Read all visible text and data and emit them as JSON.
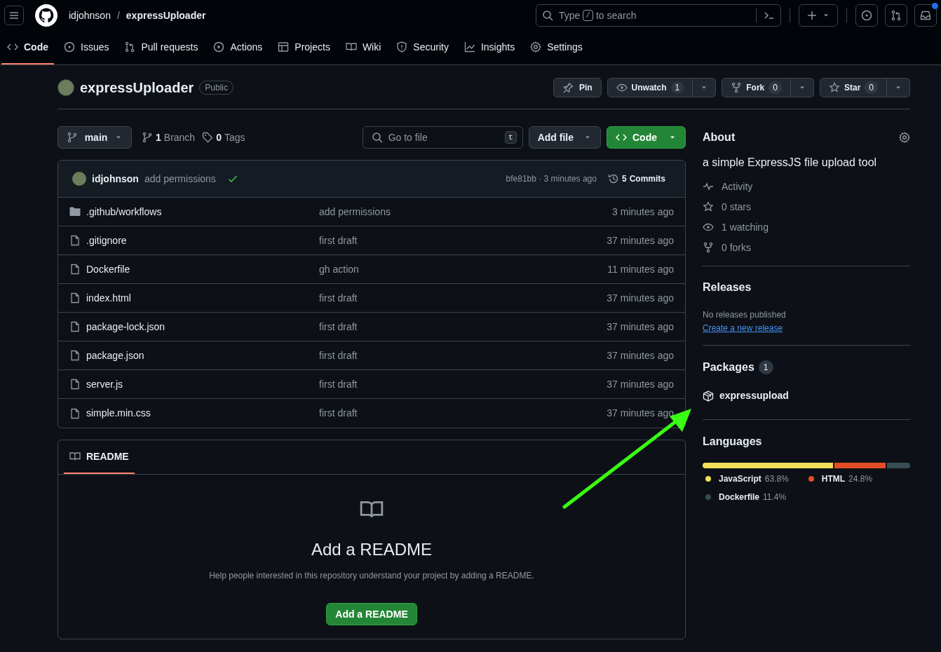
{
  "header": {
    "owner": "idjohnson",
    "separator": "/",
    "repo": "expressUploader",
    "search_placeholder_before": "Type",
    "search_key": "/",
    "search_placeholder_after": "to search",
    "notification_dot": true
  },
  "tabs": [
    {
      "label": "Code",
      "selected": true
    },
    {
      "label": "Issues",
      "selected": false
    },
    {
      "label": "Pull requests",
      "selected": false
    },
    {
      "label": "Actions",
      "selected": false
    },
    {
      "label": "Projects",
      "selected": false
    },
    {
      "label": "Wiki",
      "selected": false
    },
    {
      "label": "Security",
      "selected": false
    },
    {
      "label": "Insights",
      "selected": false
    },
    {
      "label": "Settings",
      "selected": false
    }
  ],
  "repo": {
    "name": "expressUploader",
    "visibility": "Public",
    "pin": "Pin",
    "watch": {
      "label": "Unwatch",
      "count": "1"
    },
    "fork": {
      "label": "Fork",
      "count": "0"
    },
    "star": {
      "label": "Star",
      "count": "0"
    }
  },
  "toolbar": {
    "branch": "main",
    "branches_count": "1",
    "branches_label": "Branch",
    "tags_count": "0",
    "tags_label": "Tags",
    "goto_placeholder": "Go to file",
    "goto_key": "t",
    "add_file": "Add file",
    "code": "Code"
  },
  "commit": {
    "author": "idjohnson",
    "message": "add permissions",
    "status_ok": true,
    "sha_time": "bfe81bb · 3 minutes ago",
    "commits_count": "5",
    "commits_label": "Commits"
  },
  "files": [
    {
      "kind": "folder",
      "name": ".github/workflows",
      "message": "add permissions",
      "time": "3 minutes ago"
    },
    {
      "kind": "file",
      "name": ".gitignore",
      "message": "first draft",
      "time": "37 minutes ago"
    },
    {
      "kind": "file",
      "name": "Dockerfile",
      "message": "gh action",
      "time": "11 minutes ago"
    },
    {
      "kind": "file",
      "name": "index.html",
      "message": "first draft",
      "time": "37 minutes ago"
    },
    {
      "kind": "file",
      "name": "package-lock.json",
      "message": "first draft",
      "time": "37 minutes ago"
    },
    {
      "kind": "file",
      "name": "package.json",
      "message": "first draft",
      "time": "37 minutes ago"
    },
    {
      "kind": "file",
      "name": "server.js",
      "message": "first draft",
      "time": "37 minutes ago"
    },
    {
      "kind": "file",
      "name": "simple.min.css",
      "message": "first draft",
      "time": "37 minutes ago"
    }
  ],
  "readme": {
    "tab": "README",
    "title": "Add a README",
    "text": "Help people interested in this repository understand your project by adding a README.",
    "button": "Add a README"
  },
  "about": {
    "title": "About",
    "description": "a simple ExpressJS file upload tool",
    "stats": [
      "Activity",
      "0 stars",
      "1 watching",
      "0 forks"
    ]
  },
  "releases": {
    "title": "Releases",
    "text": "No releases published",
    "link": "Create a new release"
  },
  "packages": {
    "title": "Packages",
    "count": "1",
    "items": [
      "expressupload"
    ]
  },
  "languages": {
    "title": "Languages",
    "items": [
      {
        "name": "JavaScript",
        "percent": "63.8%",
        "color": "#f1e05a"
      },
      {
        "name": "HTML",
        "percent": "24.8%",
        "color": "#e34c26"
      },
      {
        "name": "Dockerfile",
        "percent": "11.4%",
        "color": "#384d54"
      }
    ]
  },
  "annotations": [
    {
      "kind": "arrow",
      "color": "#39ff14"
    }
  ]
}
